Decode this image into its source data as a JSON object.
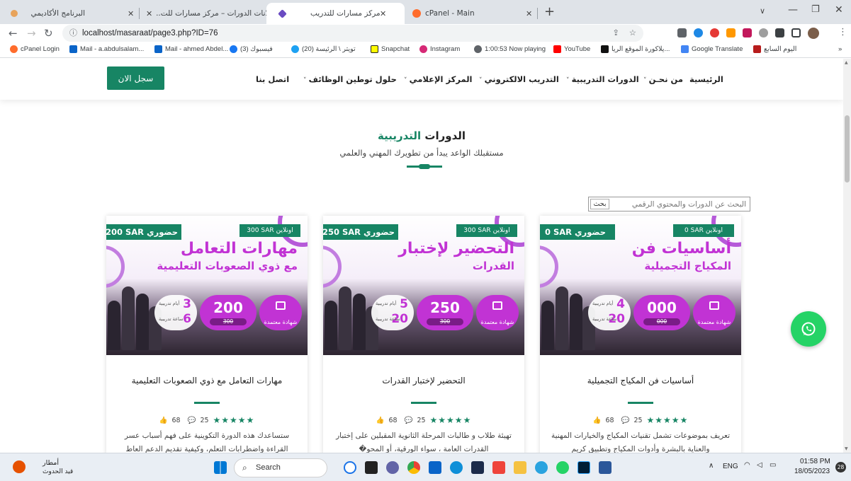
{
  "browser": {
    "tabs": [
      {
        "title": "البرنامج الأكاديمي",
        "active": false
      },
      {
        "title": "إعلانات الدورات – مركز مسارات للت...",
        "active": false
      },
      {
        "title": "مركز مسارات للتدريب",
        "active": true
      },
      {
        "title": "cPanel - Main",
        "active": false
      }
    ],
    "url": "localhost/masaraat/page3.php?ID=76",
    "bookmarks": [
      "cPanel Login",
      "Mail - a.abdulsalam...",
      "Mail - ahmed Abdel...",
      "(3) فيسبوك",
      "(20) تويتر \\ الرئيسة",
      "Snapchat",
      "Instagram",
      "1:00:53 Now playing",
      "YouTube",
      "يلاكورة الموقع الريا...",
      "Google Translate",
      "اليوم السابع"
    ]
  },
  "nav": {
    "items": [
      "الرئيسية",
      "من نحـن",
      "الدورات التدريبية",
      "التدريب الالكتروني",
      "المركز الإعلامي",
      "حلول توطين الوظائف",
      "اتصل بنا"
    ],
    "register": "سجل الان"
  },
  "section": {
    "title_part1": "الدورات",
    "title_part2": "التدريبية",
    "subtitle": "مستقبلك الواعد يبدأ من تطويرك المهني والعلمي"
  },
  "search": {
    "placeholder": "البحث عن الدورات والمحتوي الرقمي",
    "button": "بحث"
  },
  "cards": [
    {
      "online_label": "اونلاين",
      "online_price": "0 SAR",
      "presence_label": "حضوري",
      "presence_price": "0 SAR",
      "img_title": "أساسيات فن",
      "img_subtitle": "المكياج التجميلية",
      "price": "000",
      "old_price": "000",
      "certificate": "شهادة معتمدة",
      "days": "4",
      "hours": "20",
      "days_label": "أيام تدريبية",
      "hours_label": "ساعة تدريبية",
      "name": "أساسيات فن المكياج التجميلية",
      "likes": "68",
      "comments": "25",
      "stars": "★★★★★",
      "description": "تعريف بموضوعات تشمل تقنيات المكياج والخيارات المهنية والعناية بالبشرة وأدوات المكياج وتطبيق كريم"
    },
    {
      "online_label": "اونلاين",
      "online_price": "300 SAR",
      "presence_label": "حضوري",
      "presence_price": "250 SAR",
      "img_title": "التحضير لإختبار",
      "img_subtitle": "القدرات",
      "price": "250",
      "old_price": "300",
      "certificate": "شهادة معتمدة",
      "days": "5",
      "hours": "20",
      "days_label": "أيام تدريبية",
      "hours_label": "ساعة تدريبية",
      "name": "التحضير لإختبار القدرات",
      "likes": "68",
      "comments": "25",
      "stars": "★★★★★",
      "description": "تهيئة طلاب و طالبات المرحلة الثانوية المقبلين على إختبار القدرات العامة ، سواء الورقية، أو المحو�"
    },
    {
      "online_label": "اونلاين",
      "online_price": "300 SAR",
      "presence_label": "حضوري",
      "presence_price": "200 SAR",
      "img_title": "مهارات التعامل",
      "img_subtitle": "مع ذوي الصعوبات التعليمية",
      "price": "200",
      "old_price": "300",
      "certificate": "شهادة معتمدة",
      "days": "3",
      "hours": "6",
      "days_label": "أيام تدريبية",
      "hours_label": "ساعة تدريبية",
      "name": "مهارات التعامل مع ذوي الصعوبات التعليمية",
      "likes": "68",
      "comments": "25",
      "stars": "★★★★★",
      "description": "ستساعدك هذه الدورة التكوينية على فهم أسباب عسر القراءة واضطرابات التعلم، وكيفية تقديم الدعم العاط"
    }
  ],
  "taskbar": {
    "weather_title": "أمطار",
    "weather_sub": "قيد الحدوث",
    "search": "Search",
    "lang": "ENG",
    "time": "01:58 PM",
    "date": "18/05/2023",
    "notif": "28"
  },
  "colors": {
    "brand_green": "#178564",
    "brand_purple": "#c133d4",
    "whatsapp": "#25d366"
  }
}
